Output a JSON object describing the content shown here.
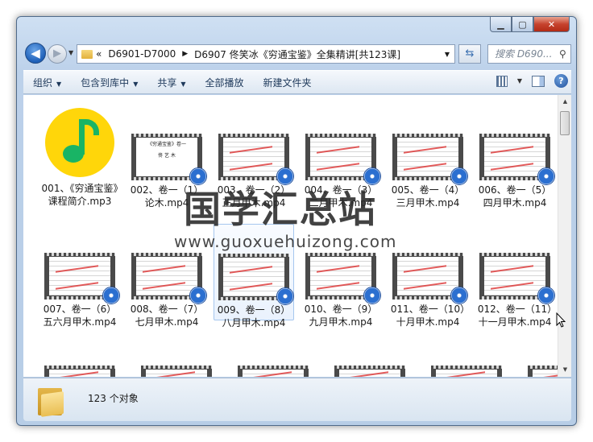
{
  "window": {
    "buttons": {
      "minimize": "▁",
      "maximize": "▢",
      "close": "✕"
    }
  },
  "nav": {
    "back": "◀",
    "forward": "▶",
    "history_drop": "▼",
    "breadcrumb_prefix": "«",
    "breadcrumbs": [
      "D6901-D7000",
      "D6907 佟笑冰《穷通宝鉴》全集精讲[共123课]"
    ],
    "separator": "▶",
    "address_drop": "▼",
    "refresh": "⇆",
    "search_placeholder": "搜索 D690...",
    "search_icon": "⚲"
  },
  "toolbar": {
    "items": [
      "组织",
      "包含到库中",
      "共享",
      "全部播放",
      "新建文件夹"
    ],
    "dropdown_arrow": "▼",
    "help": "?"
  },
  "items": [
    {
      "label": "001、《穷通宝鉴》课程简介.mp3",
      "type": "audio",
      "icon": "qq-music-icon"
    },
    {
      "label": "002、卷一（1）论木.mp4",
      "type": "video",
      "first": true,
      "thumb_title": "《穷通宝鉴》卷一",
      "thumb_sub": "佟 艺 木"
    },
    {
      "label": "003、卷一（2）正月甲木.mp4",
      "type": "video"
    },
    {
      "label": "004、卷一（3）二月甲木.mp4",
      "type": "video"
    },
    {
      "label": "005、卷一（4）三月甲木.mp4",
      "type": "video"
    },
    {
      "label": "006、卷一（5）四月甲木.mp4",
      "type": "video"
    },
    {
      "label": "007、卷一（6）五六月甲木.mp4",
      "type": "video"
    },
    {
      "label": "008、卷一（7）七月甲木.mp4",
      "type": "video"
    },
    {
      "label": "009、卷一（8）八月甲木.mp4",
      "type": "video",
      "selected": true
    },
    {
      "label": "010、卷一（9）九月甲木.mp4",
      "type": "video"
    },
    {
      "label": "011、卷一（10）十月甲木.mp4",
      "type": "video"
    },
    {
      "label": "012、卷一（11）十一月甲木.mp4",
      "type": "video"
    }
  ],
  "status": {
    "count_text": "123 个对象"
  },
  "watermark": {
    "text": "国学汇总站",
    "url": "www.guoxuehuizong.com"
  }
}
